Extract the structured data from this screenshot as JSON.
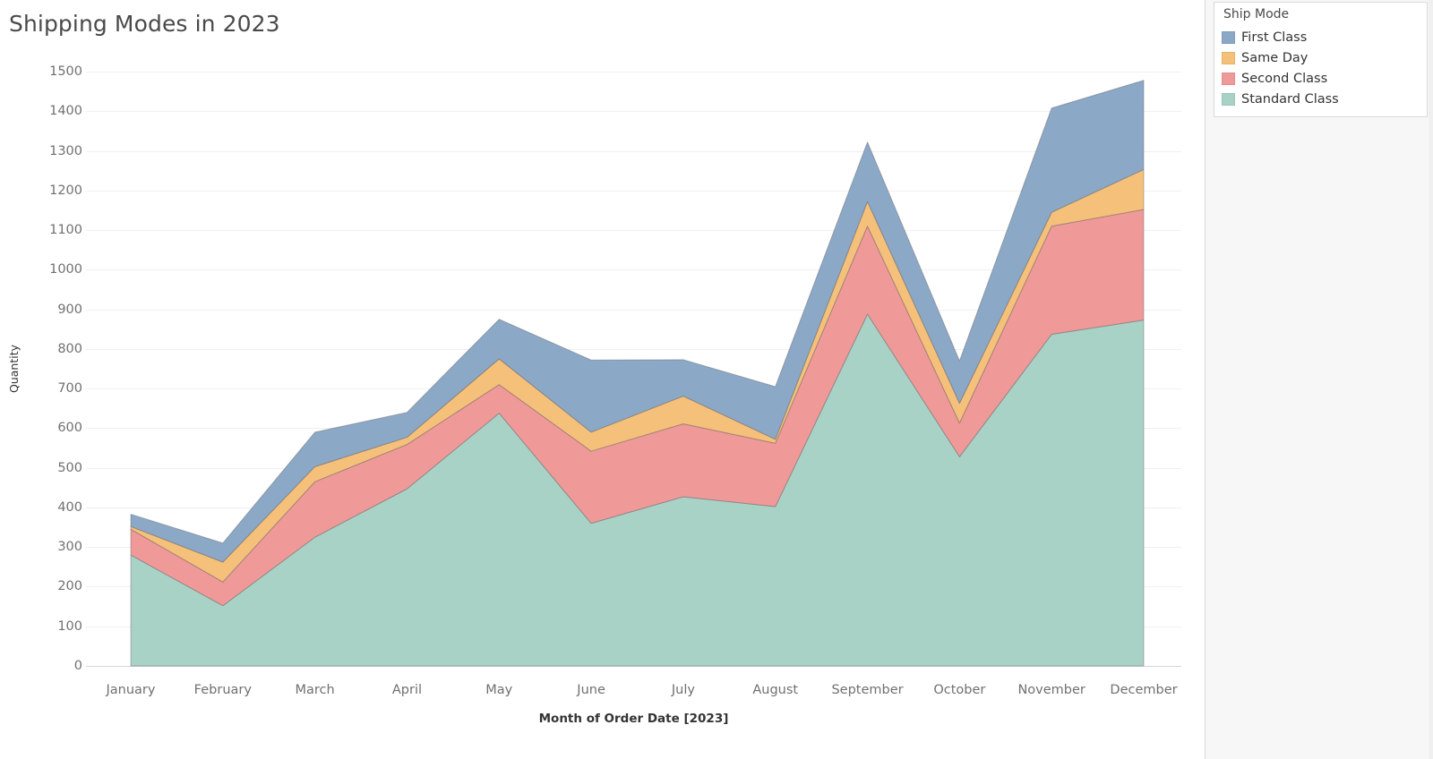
{
  "chart": {
    "title": "Shipping Modes in 2023",
    "y_axis_title": "Quantity",
    "x_axis_title": "Month of Order Date [2023]",
    "y_ticks": [
      "0",
      "100",
      "200",
      "300",
      "400",
      "500",
      "600",
      "700",
      "800",
      "900",
      "1000",
      "1100",
      "1200",
      "1300",
      "1400",
      "1500"
    ]
  },
  "legend": {
    "title": "Ship Mode",
    "items": [
      {
        "label": "First Class",
        "color": "#8ca8c7"
      },
      {
        "label": "Same Day",
        "color": "#f5c07a"
      },
      {
        "label": "Second Class",
        "color": "#ef9a99"
      },
      {
        "label": "Standard Class",
        "color": "#a9d2c7"
      }
    ]
  },
  "chart_data": {
    "type": "area",
    "stacked": true,
    "title": "Shipping Modes in 2023",
    "xlabel": "Month of Order Date [2023]",
    "ylabel": "Quantity",
    "ylim": [
      0,
      1500
    ],
    "ytick_step": 100,
    "grid": true,
    "legend_position": "right",
    "legend_title": "Ship Mode",
    "categories": [
      "January",
      "February",
      "March",
      "April",
      "May",
      "June",
      "July",
      "August",
      "September",
      "October",
      "November",
      "December"
    ],
    "series": [
      {
        "name": "Standard Class",
        "color": "#a9d2c7",
        "values": [
          280,
          152,
          325,
          447,
          638,
          360,
          427,
          402,
          888,
          528,
          837,
          873
        ]
      },
      {
        "name": "Second Class",
        "color": "#ef9a99",
        "values": [
          65,
          60,
          140,
          112,
          72,
          182,
          184,
          160,
          222,
          85,
          273,
          279
        ]
      },
      {
        "name": "Same Day",
        "color": "#f5c07a",
        "values": [
          7,
          50,
          38,
          18,
          65,
          48,
          70,
          10,
          62,
          50,
          35,
          101
        ]
      },
      {
        "name": "First Class",
        "color": "#8ca8c7",
        "values": [
          31,
          48,
          87,
          63,
          100,
          182,
          92,
          133,
          150,
          107,
          263,
          225
        ]
      }
    ],
    "stacked_tops": {
      "Standard Class": [
        280,
        152,
        325,
        447,
        638,
        360,
        427,
        402,
        888,
        528,
        837,
        873
      ],
      "Second Class": [
        345,
        212,
        465,
        559,
        710,
        542,
        611,
        562,
        1110,
        613,
        1110,
        1152
      ],
      "Same Day": [
        352,
        262,
        503,
        577,
        775,
        590,
        681,
        572,
        1172,
        663,
        1145,
        1253
      ],
      "First Class": [
        383,
        310,
        590,
        640,
        875,
        772,
        773,
        705,
        1322,
        770,
        1408,
        1478
      ]
    },
    "totals": [
      383,
      310,
      590,
      640,
      875,
      772,
      773,
      705,
      1322,
      770,
      1408,
      1478
    ]
  }
}
